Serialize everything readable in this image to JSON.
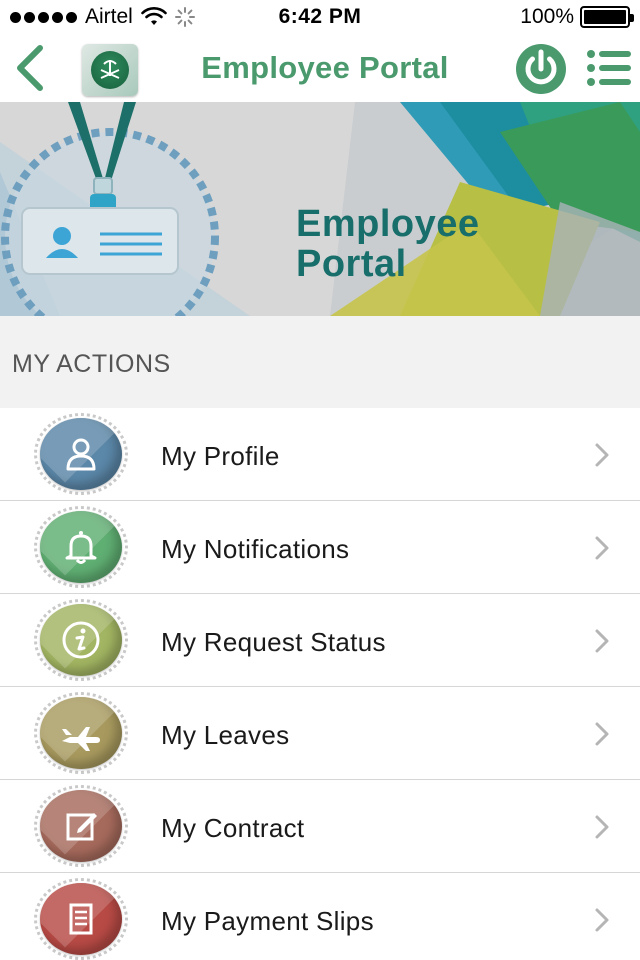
{
  "status_bar": {
    "carrier": "Airtel",
    "time": "6:42 PM",
    "battery": "100%"
  },
  "nav": {
    "title": "Employee Portal",
    "icons": [
      "back-chevron-icon",
      "app-logo",
      "power-icon",
      "list-menu-icon"
    ],
    "accent_color": "#4a9a6e"
  },
  "banner": {
    "title_line1": "Employee",
    "title_line2": "Portal",
    "title_color": "#176e6a"
  },
  "section": {
    "title": "MY ACTIONS"
  },
  "actions": [
    {
      "label": "My Profile",
      "icon": "user-icon",
      "color": "#5b87a8"
    },
    {
      "label": "My Notifications",
      "icon": "bell-icon",
      "color": "#5fae72"
    },
    {
      "label": "My Request Status",
      "icon": "info-icon",
      "color": "#a2b562"
    },
    {
      "label": "My Leaves",
      "icon": "airplane-icon",
      "color": "#a89a5e"
    },
    {
      "label": "My Contract",
      "icon": "edit-icon",
      "color": "#a66a5c"
    },
    {
      "label": "My Payment Slips",
      "icon": "document-icon",
      "color": "#b84a45"
    }
  ]
}
